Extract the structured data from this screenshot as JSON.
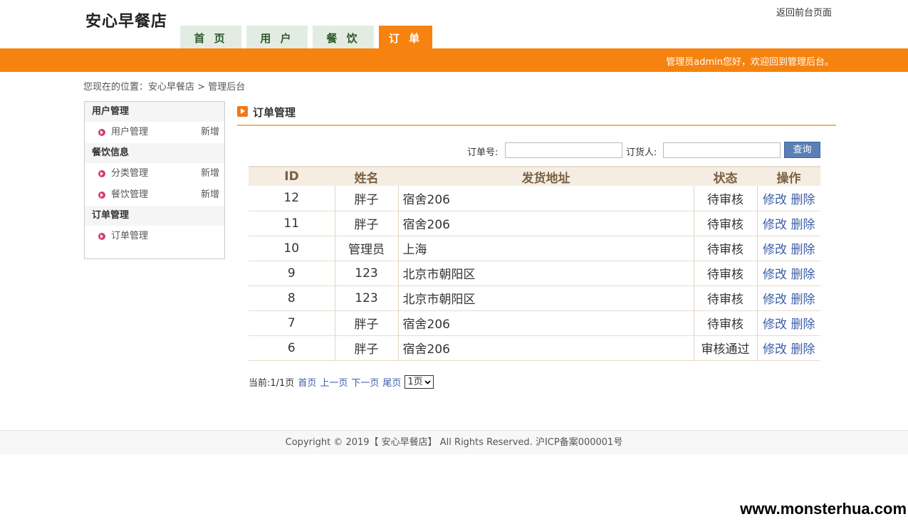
{
  "header": {
    "site_title": "安心早餐店",
    "back_link": "返回前台页面",
    "tabs": [
      {
        "label": "首 页",
        "active": false
      },
      {
        "label": "用 户",
        "active": false
      },
      {
        "label": "餐 饮",
        "active": false
      },
      {
        "label": "订 单",
        "active": true
      }
    ],
    "welcome": "管理员admin您好，欢迎回到管理后台。"
  },
  "breadcrumb": {
    "prefix": "您现在的位置：",
    "home": "安心早餐店",
    "sep": " > ",
    "current": "管理后台"
  },
  "sidebar": {
    "group_user": "用户管理",
    "item_user": "用户管理",
    "item_user_add": "新增",
    "group_food": "餐饮信息",
    "item_category": "分类管理",
    "item_category_add": "新增",
    "item_food": "餐饮管理",
    "item_food_add": "新增",
    "group_order": "订单管理",
    "item_order": "订单管理"
  },
  "panel": {
    "title": "订单管理"
  },
  "search": {
    "order_no_label": "订单号:",
    "orderer_label": "订货人:",
    "order_no_value": "",
    "orderer_value": "",
    "button": "查询"
  },
  "table": {
    "columns": [
      "ID",
      "姓名",
      "发货地址",
      "状态",
      "操作"
    ],
    "rows": [
      {
        "id": "12",
        "name": "胖子",
        "address": "宿舍206",
        "status": "待审核",
        "edit": "修改",
        "delete": "删除"
      },
      {
        "id": "11",
        "name": "胖子",
        "address": "宿舍206",
        "status": "待审核",
        "edit": "修改",
        "delete": "删除"
      },
      {
        "id": "10",
        "name": "管理员",
        "address": "上海",
        "status": "待审核",
        "edit": "修改",
        "delete": "删除"
      },
      {
        "id": "9",
        "name": "123",
        "address": "北京市朝阳区",
        "status": "待审核",
        "edit": "修改",
        "delete": "删除"
      },
      {
        "id": "8",
        "name": "123",
        "address": "北京市朝阳区",
        "status": "待审核",
        "edit": "修改",
        "delete": "删除"
      },
      {
        "id": "7",
        "name": "胖子",
        "address": "宿舍206",
        "status": "待审核",
        "edit": "修改",
        "delete": "删除"
      },
      {
        "id": "6",
        "name": "胖子",
        "address": "宿舍206",
        "status": "审核通过",
        "edit": "修改",
        "delete": "删除"
      }
    ]
  },
  "pager": {
    "current": "当前:1/1页",
    "first": "首页",
    "prev": "上一页",
    "next": "下一页",
    "last": "尾页",
    "select_value": "1页"
  },
  "footer": {
    "text": "Copyright © 2019【 安心早餐店】 All Rights Reserved. 沪ICP备案000001号"
  },
  "watermark": "www.monsterhua.com",
  "colors": {
    "accent": "#f6830f",
    "tab_bg": "#e3ece3",
    "link": "#3b5ea8",
    "table_header_bg": "#f5ede2"
  }
}
